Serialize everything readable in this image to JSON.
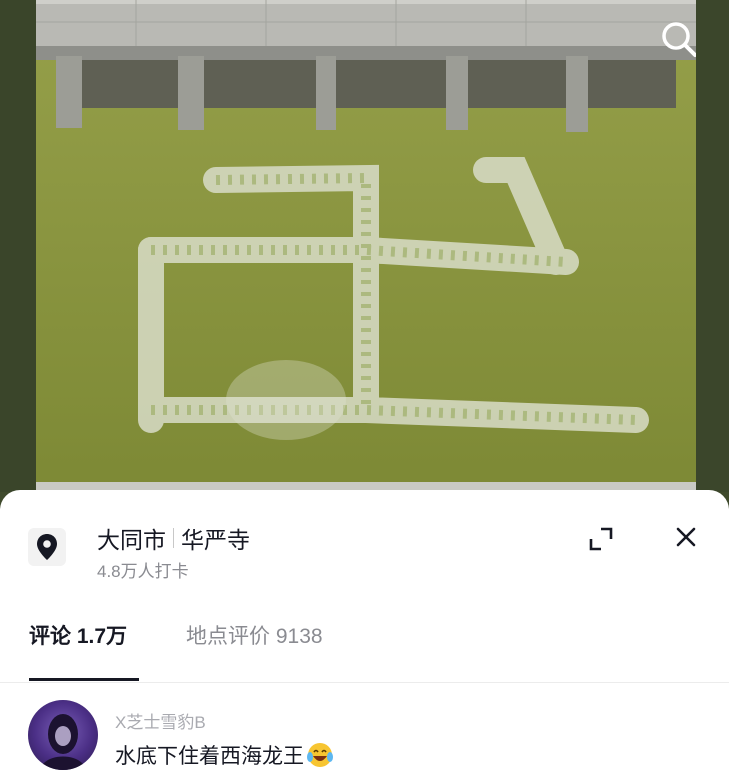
{
  "photo": {
    "alt_subject": "",
    "search_icon": "search-icon"
  },
  "location": {
    "city": "大同市",
    "place": "华严寺",
    "checkins": "4.8万人打卡",
    "icon": "location-pin-icon"
  },
  "actions": {
    "expand_icon": "expand-icon",
    "close_icon": "close-icon"
  },
  "tabs": [
    {
      "label": "评论 1.7万",
      "active": true
    },
    {
      "label": "地点评价 9138",
      "active": false
    }
  ],
  "comments": [
    {
      "username": "X芝士雪豹B",
      "text": "水底下住着西海龙王",
      "emoji": "laughing-crying-emoji"
    }
  ],
  "colors": {
    "text_primary": "#161823",
    "text_secondary": "#8a8b91",
    "water": "#8c963e"
  }
}
